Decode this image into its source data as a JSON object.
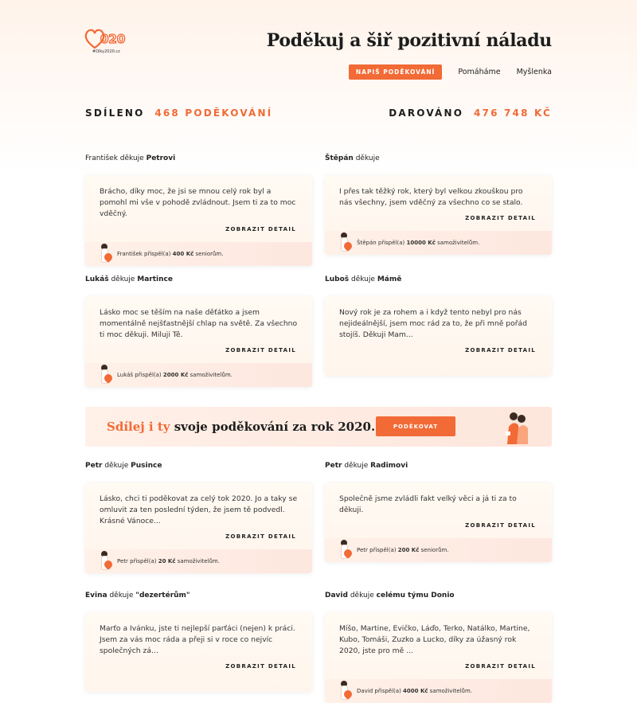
{
  "header": {
    "logo_text": "#Díky2020.cz",
    "title": "Poděkuj a šiř pozitivní náladu",
    "nav": {
      "cta": "NAPIŠ PODĚKOVÁNÍ",
      "links": [
        "Pomáháme",
        "Myšlenka"
      ]
    }
  },
  "stats": {
    "shared_label": "SDÍLENO",
    "shared_value": "468 PODĚKOVÁNÍ",
    "donated_label": "DAROVÁNO",
    "donated_value": "476 748 KČ"
  },
  "cards": [
    {
      "from": "František",
      "verb": "děkuje",
      "to": "Petrovi",
      "text": "Brácho, díky moc, že jsi se mnou celý rok byl a pomohl mi vše v pohodě zvládnout. Jsem ti za to moc vděčný.",
      "detail": "ZOBRAZIT DETAIL",
      "donor": "František přispěl(a)",
      "amount": "400 Kč",
      "recipient": "seniorům."
    },
    {
      "from": "Štěpán",
      "verb": "děkuje",
      "to": "",
      "text": "I přes tak těžký rok, který byl velkou zkouškou pro nás všechny, jsem vděčný za všechno co se stalo.",
      "detail": "ZOBRAZIT DETAIL",
      "donor": "Štěpán přispěl(a)",
      "amount": "10000 Kč",
      "recipient": "samoživitelům."
    },
    {
      "from": "Lukáš",
      "verb": "děkuje",
      "to": "Martince",
      "text": "Lásko moc se těším na naše děťátko a jsem momentálně nejšťastnější chlap na světě. Za všechno ti moc děkuji. Miluji Tě.",
      "detail": "ZOBRAZIT DETAIL",
      "donor": "Lukáš přispěl(a)",
      "amount": "2000 Kč",
      "recipient": "samoživitelům."
    },
    {
      "from": "Luboš",
      "verb": "děkuje",
      "to": "Mámě",
      "text": "Nový rok je za rohem a i když tento nebyl pro nás nejideálnější, jsem moc rád za to, že při mně pořád stojíš. Děkuji Mam...",
      "detail": "ZOBRAZIT DETAIL",
      "donor": "",
      "amount": "",
      "recipient": ""
    },
    {
      "from": "Petr",
      "verb": "děkuje",
      "to": "Pusince",
      "text": "Lásko, chci ti poděkovat za celý tok 2020. Jo a taky se omluvit za ten poslední týden, že jsem tě podvedl. Krásné Vánoce...",
      "detail": "ZOBRAZIT DETAIL",
      "donor": "Petr přispěl(a)",
      "amount": "20 Kč",
      "recipient": "samoživitelům."
    },
    {
      "from": "Petr",
      "verb": "děkuje",
      "to": "Radimovi",
      "text": "Společně jsme zvládli fakt velký věci a já ti za to děkuji.",
      "detail": "ZOBRAZIT DETAIL",
      "donor": "Petr přispěl(a)",
      "amount": "200 Kč",
      "recipient": "seniorům."
    },
    {
      "from": "Evina",
      "verb": "děkuje",
      "to": "\"dezertérům\"",
      "text": "Marťo a Ivánku, jste ti nejlepší parťáci (nejen) k práci. Jsem za vás moc ráda a přeji si v roce co nejvíc společných zá...",
      "detail": "ZOBRAZIT DETAIL",
      "donor": "",
      "amount": "",
      "recipient": ""
    },
    {
      "from": "David",
      "verb": "děkuje",
      "to": "celému týmu Donio",
      "text": "Míšo, Martine, Evičko, Láďo, Terko, Natálko, Martine, Kubo, Tomáši, Zuzko a Lucko, díky za úžasný rok 2020, jste pro mě ...",
      "detail": "ZOBRAZIT DETAIL",
      "donor": "David přispěl(a)",
      "amount": "4000 Kč",
      "recipient": "samoživitelům."
    }
  ],
  "banner": {
    "text_highlight": "Sdílej i ty",
    "text_rest": "svoje poděkování za rok 2020.",
    "button": "PODĚKOVAT"
  },
  "colors": {
    "accent": "#f26a35"
  }
}
